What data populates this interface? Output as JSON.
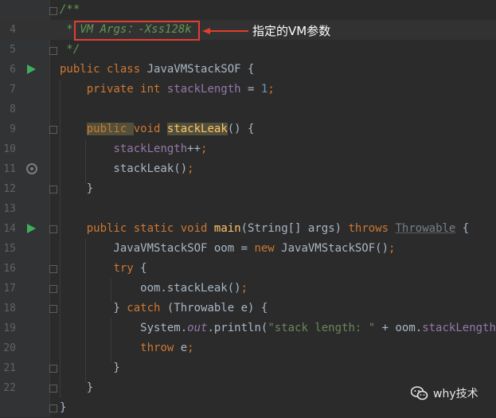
{
  "editor": {
    "lines": [
      {
        "num": "",
        "tokens": [
          {
            "t": "/**",
            "c": "cmt"
          }
        ]
      },
      {
        "num": "4",
        "tokens": [
          {
            "t": " * ",
            "c": "cmt"
          },
          {
            "t": "VM Args：-Xss128k",
            "c": "cmt"
          }
        ]
      },
      {
        "num": "5",
        "tokens": [
          {
            "t": " */",
            "c": "cmt"
          }
        ]
      },
      {
        "num": "6",
        "tokens": [
          {
            "t": "public ",
            "c": "kw"
          },
          {
            "t": "class ",
            "c": "kw"
          },
          {
            "t": "JavaVMStackSOF {",
            "c": ""
          }
        ]
      },
      {
        "num": "7",
        "tokens": [
          {
            "t": "    private ",
            "c": "kw"
          },
          {
            "t": "int ",
            "c": "kw"
          },
          {
            "t": "stackLength",
            "c": "field"
          },
          {
            "t": " = ",
            "c": ""
          },
          {
            "t": "1",
            "c": "num"
          },
          {
            "t": ";",
            "c": "kw"
          }
        ]
      },
      {
        "num": "8",
        "tokens": []
      },
      {
        "num": "9",
        "tokens": [
          {
            "t": "    ",
            "c": ""
          },
          {
            "t": "public ",
            "c": "kw hl"
          },
          {
            "t": "void ",
            "c": "kw"
          },
          {
            "t": "stackLeak",
            "c": "fn hl"
          },
          {
            "t": "() {",
            "c": ""
          }
        ]
      },
      {
        "num": "10",
        "tokens": [
          {
            "t": "        ",
            "c": ""
          },
          {
            "t": "stackLength",
            "c": "field"
          },
          {
            "t": "++",
            "c": ""
          },
          {
            "t": ";",
            "c": "kw"
          }
        ]
      },
      {
        "num": "11",
        "tokens": [
          {
            "t": "        stackLeak()",
            "c": ""
          },
          {
            "t": ";",
            "c": "kw"
          }
        ]
      },
      {
        "num": "12",
        "tokens": [
          {
            "t": "    }",
            "c": ""
          }
        ]
      },
      {
        "num": "13",
        "tokens": []
      },
      {
        "num": "14",
        "tokens": [
          {
            "t": "    ",
            "c": ""
          },
          {
            "t": "public ",
            "c": "kw"
          },
          {
            "t": "static ",
            "c": "kw"
          },
          {
            "t": "void ",
            "c": "kw"
          },
          {
            "t": "main",
            "c": "fn"
          },
          {
            "t": "(String[] args) ",
            "c": ""
          },
          {
            "t": "throws ",
            "c": "kw"
          },
          {
            "t": "Throwable",
            "c": "dim ul"
          },
          {
            "t": " {",
            "c": ""
          }
        ]
      },
      {
        "num": "15",
        "tokens": [
          {
            "t": "        JavaVMStackSOF oom = ",
            "c": ""
          },
          {
            "t": "new ",
            "c": "kw"
          },
          {
            "t": "JavaVMStackSOF()",
            "c": ""
          },
          {
            "t": ";",
            "c": "kw"
          }
        ]
      },
      {
        "num": "16",
        "tokens": [
          {
            "t": "        ",
            "c": ""
          },
          {
            "t": "try ",
            "c": "kw"
          },
          {
            "t": "{",
            "c": ""
          }
        ]
      },
      {
        "num": "17",
        "tokens": [
          {
            "t": "            oom.stackLeak()",
            "c": ""
          },
          {
            "t": ";",
            "c": "kw"
          }
        ]
      },
      {
        "num": "18",
        "tokens": [
          {
            "t": "        } ",
            "c": ""
          },
          {
            "t": "catch ",
            "c": "kw"
          },
          {
            "t": "(Throwable e) {",
            "c": ""
          }
        ]
      },
      {
        "num": "19",
        "tokens": [
          {
            "t": "            System.",
            "c": ""
          },
          {
            "t": "out",
            "c": "stat"
          },
          {
            "t": ".println(",
            "c": ""
          },
          {
            "t": "\"stack length: \"",
            "c": "str"
          },
          {
            "t": " + oom.",
            "c": ""
          },
          {
            "t": "stackLength",
            "c": "field"
          },
          {
            "t": ")",
            "c": ""
          },
          {
            "t": ";",
            "c": "kw"
          }
        ]
      },
      {
        "num": "20",
        "tokens": [
          {
            "t": "            ",
            "c": ""
          },
          {
            "t": "throw ",
            "c": "kw"
          },
          {
            "t": "e",
            "c": ""
          },
          {
            "t": ";",
            "c": "kw"
          }
        ]
      },
      {
        "num": "21",
        "tokens": [
          {
            "t": "        }",
            "c": ""
          }
        ]
      },
      {
        "num": "22",
        "tokens": [
          {
            "t": "    }",
            "c": ""
          }
        ]
      },
      {
        "num": "",
        "tokens": [
          {
            "t": "}",
            "c": ""
          }
        ]
      }
    ]
  },
  "gutter_icons": {
    "run_class": "run-class-icon",
    "run_main": "run-main-icon",
    "recursive_call": "recursive-call-icon"
  },
  "annotation": {
    "label": "指定的VM参数",
    "box_color": "#e23e2e"
  },
  "watermark": {
    "text": "why技术",
    "icon": "wechat-icon"
  },
  "colors": {
    "background": "#2b2b2b",
    "keyword": "#cc7832",
    "comment": "#629755",
    "field": "#9876aa",
    "number": "#6897bb",
    "string": "#6a8759",
    "method": "#ffc66d"
  }
}
